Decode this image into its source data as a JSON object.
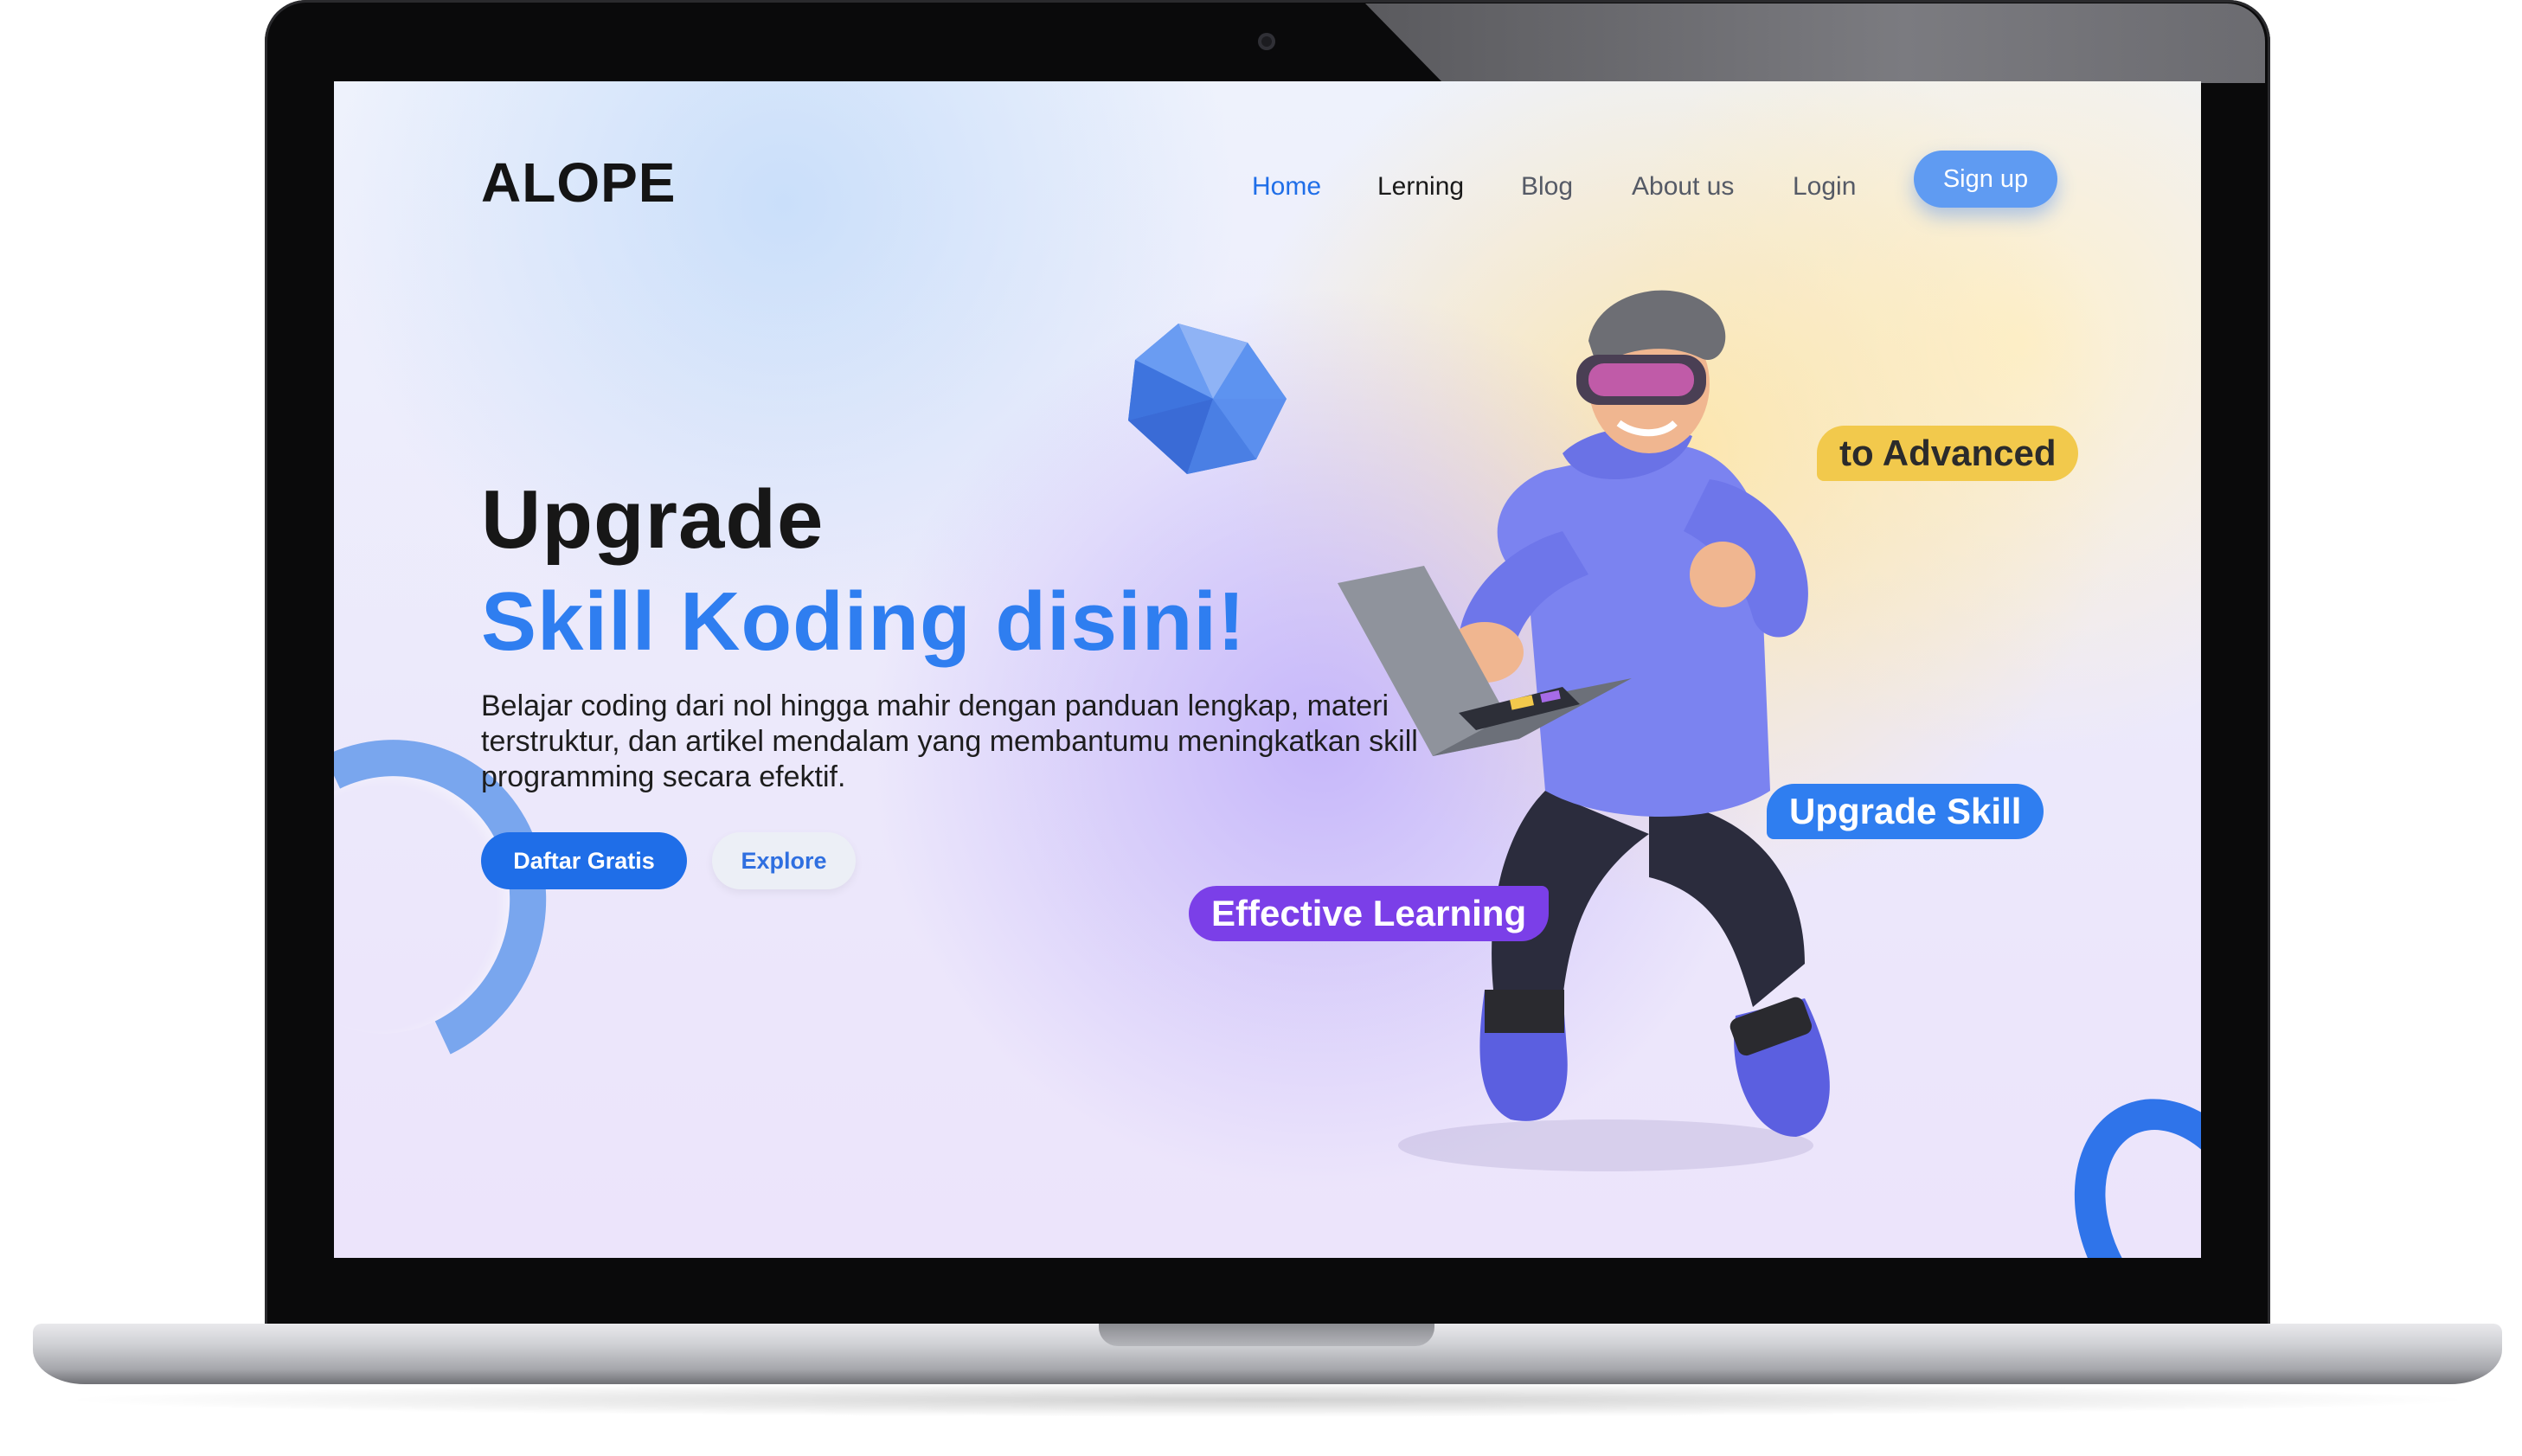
{
  "site": {
    "logo": "ALOPE",
    "nav": {
      "home": "Home",
      "learning": "Lerning",
      "blog": "Blog",
      "about": "About us",
      "login": "Login",
      "signup": "Sign up"
    }
  },
  "hero": {
    "title_line1": "Upgrade",
    "title_line2": "Skill Koding disini!",
    "description": "Belajar coding dari nol hingga mahir dengan panduan lengkap, materi terstruktur, dan artikel mendalam yang membantumu meningkatkan skill programming secara efektif.",
    "primary_button": "Daftar Gratis",
    "secondary_button": "Explore"
  },
  "tags": {
    "advanced": "to Advanced",
    "upgrade": "Upgrade Skill",
    "effective": "Effective Learning"
  },
  "colors": {
    "accent_blue": "#1f6ee8",
    "title_blue": "#2f7ef0",
    "tag_yellow": "#f2c94c",
    "tag_purple": "#7b3fe8",
    "signup_blue": "#5f9bf2"
  },
  "icons": [
    "gem-shape",
    "ring-shape",
    "person-illustration",
    "laptop-illustration"
  ]
}
